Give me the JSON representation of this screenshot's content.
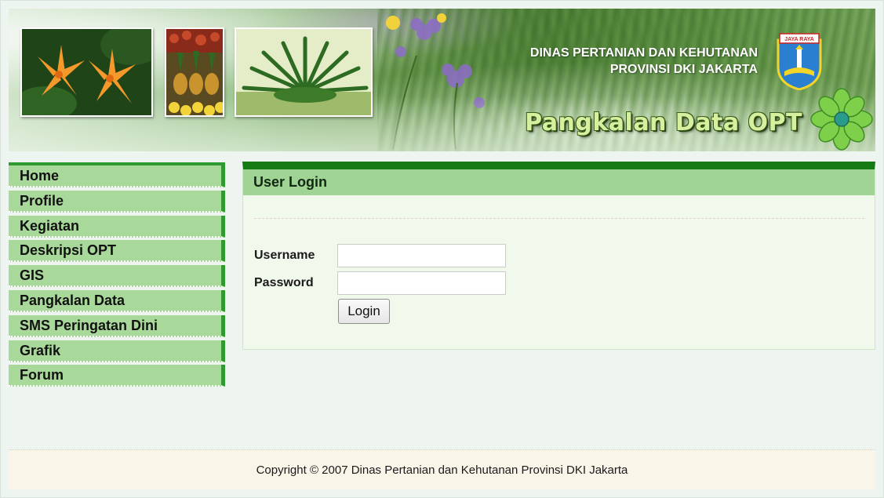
{
  "header": {
    "agency_line1": "DINAS PERTANIAN DAN KEHUTANAN",
    "agency_line2": "PROVINSI DKI JAKARTA",
    "site_title": "Pangkalan Data OPT",
    "crest_text": "JAYA RAYA",
    "photos": [
      "lily-photo",
      "fruit-photo",
      "palm-photo"
    ]
  },
  "sidebar": {
    "items": [
      {
        "label": "Home"
      },
      {
        "label": "Profile"
      },
      {
        "label": "Kegiatan"
      },
      {
        "label": "Deskripsi OPT"
      },
      {
        "label": "GIS"
      },
      {
        "label": "Pangkalan Data"
      },
      {
        "label": "SMS Peringatan Dini"
      },
      {
        "label": "Grafik"
      },
      {
        "label": "Forum"
      }
    ]
  },
  "login": {
    "title": "User Login",
    "username_label": "Username",
    "password_label": "Password",
    "username_value": "",
    "password_value": "",
    "button_label": "Login"
  },
  "footer": {
    "copyright": "Copyright © 2007 Dinas Pertanian dan Kehutanan Provinsi DKI Jakarta"
  },
  "colors": {
    "menu_bg": "#a8d99a",
    "menu_accent": "#2f9a2f",
    "panel_top_bar": "#147a14",
    "panel_header": "#9fd495",
    "footer_bg": "#f9f6e9"
  }
}
